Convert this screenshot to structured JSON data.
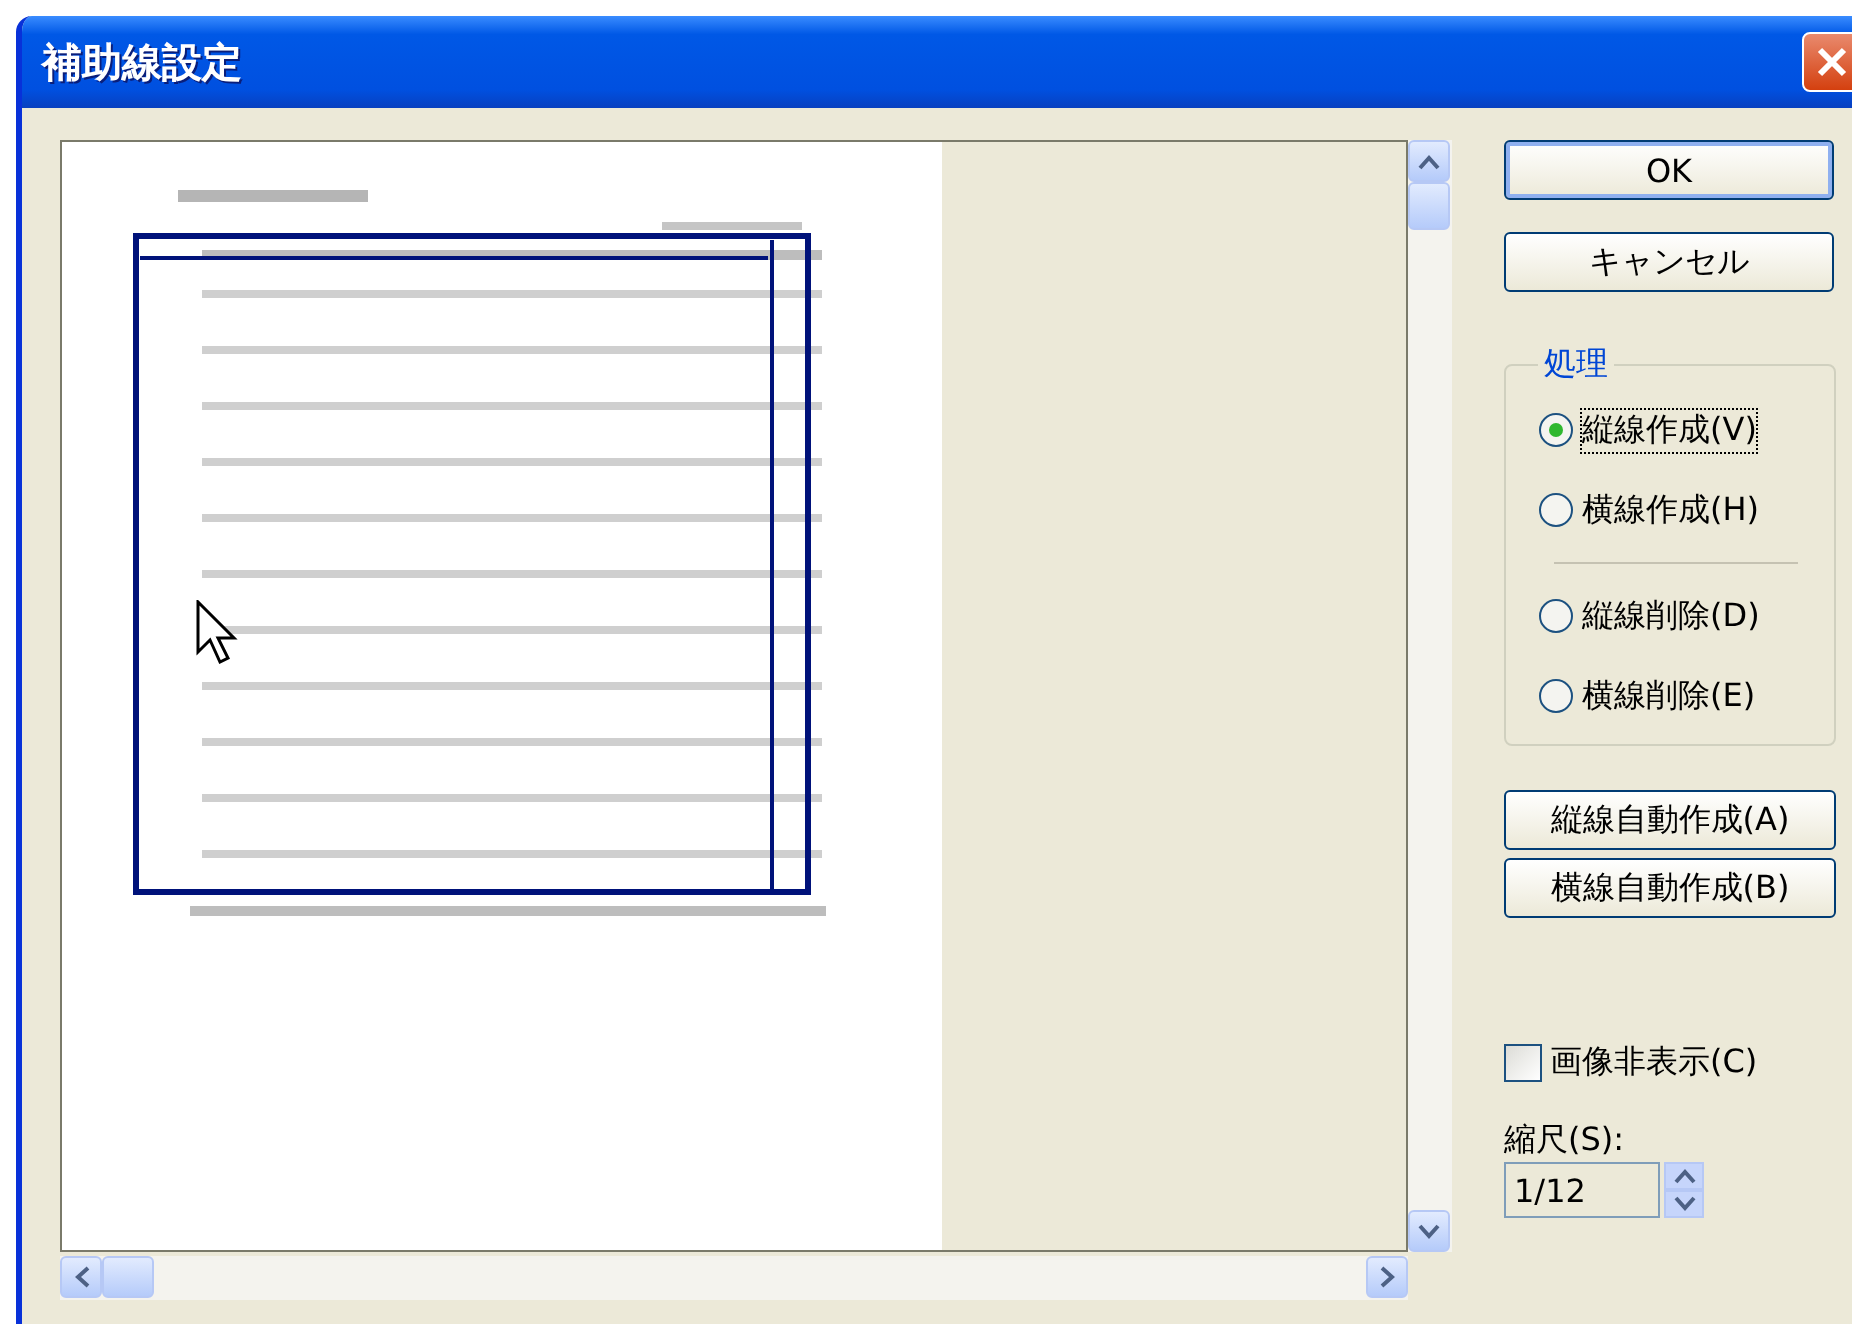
{
  "window": {
    "title": "補助線設定"
  },
  "buttons": [
    {
      "label": "OK",
      "default": true
    },
    {
      "label": "キャンセル",
      "default": false
    }
  ],
  "processing": {
    "label": "処理",
    "options": [
      {
        "label": "縦線作成(V)",
        "selected": true,
        "kind": "radio"
      },
      {
        "label": "横線作成(H)",
        "selected": false,
        "kind": "radio"
      },
      {
        "kind": "separator"
      },
      {
        "label": "縦線削除(D)",
        "selected": false,
        "kind": "radio"
      },
      {
        "label": "横線削除(E)",
        "selected": false,
        "kind": "radio"
      }
    ]
  },
  "auto_buttons": [
    {
      "label": "縦線自動作成(A)"
    },
    {
      "label": "横線自動作成(B)"
    }
  ],
  "hide_image": {
    "label": "画像非表示(C)",
    "checked": false
  },
  "scale": {
    "label": "縮尺(S):",
    "value": "1/12"
  }
}
